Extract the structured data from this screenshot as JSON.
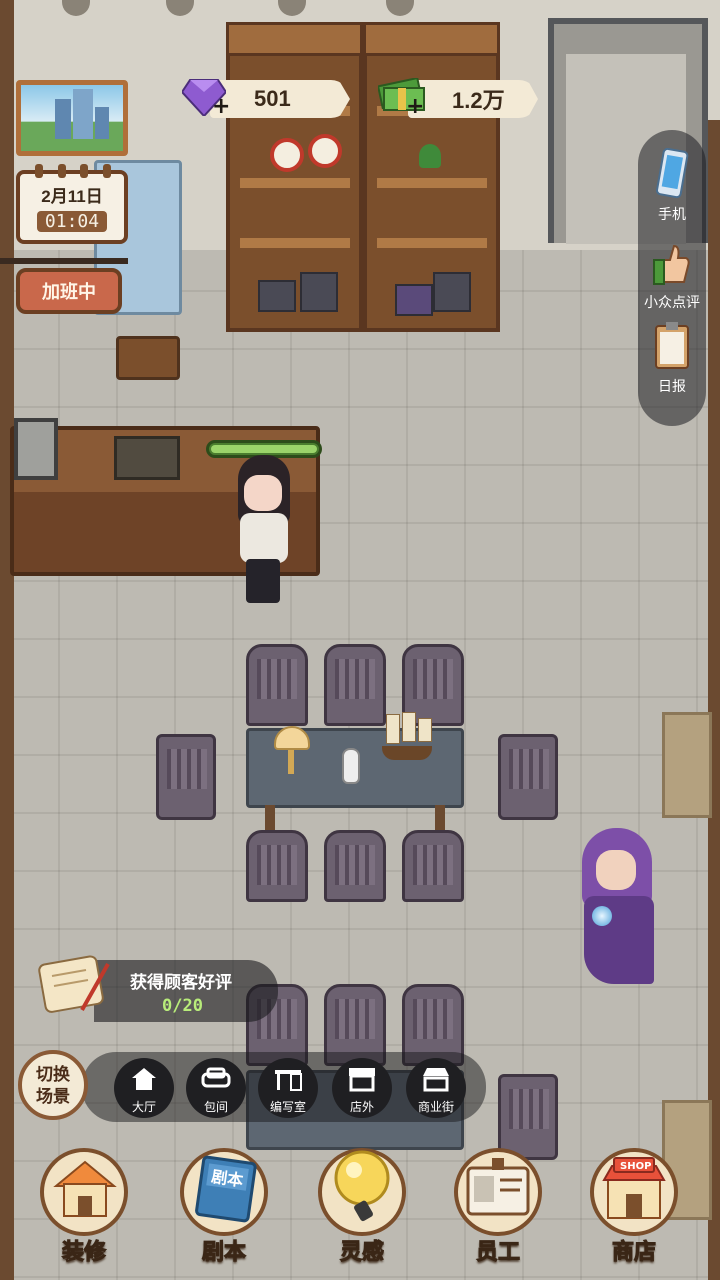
{
  "resources": {
    "gems": "501",
    "cash": "1.2万",
    "plus_symbol": "+"
  },
  "clock": {
    "date": "2月11日",
    "time": "01:04"
  },
  "status_sign": "加班中",
  "side_menu": [
    {
      "label": "手机",
      "icon": "phone-icon"
    },
    {
      "label": "小众点评",
      "icon": "thumbs-up-icon"
    },
    {
      "label": "日报",
      "icon": "clipboard-icon"
    }
  ],
  "task": {
    "title": "获得顾客好评",
    "progress": "0/20"
  },
  "scene_toggle": {
    "line1": "切换",
    "line2": "场景"
  },
  "scenes": [
    {
      "label": "大厅",
      "icon": "house-icon"
    },
    {
      "label": "包间",
      "icon": "sofa-icon"
    },
    {
      "label": "编写室",
      "icon": "desk-icon"
    },
    {
      "label": "店外",
      "icon": "storefront-icon"
    },
    {
      "label": "商业街",
      "icon": "street-icon"
    }
  ],
  "main_menu": [
    {
      "label": "装修",
      "icon": "house-renovate-icon"
    },
    {
      "label": "剧本",
      "icon": "script-book-icon",
      "badge": "剧本"
    },
    {
      "label": "灵感",
      "icon": "lightbulb-icon"
    },
    {
      "label": "员工",
      "icon": "id-card-icon"
    },
    {
      "label": "商店",
      "icon": "shop-icon",
      "badge": "SHOP"
    }
  ],
  "colors": {
    "accent_wood": "#7b4f2c",
    "gem_purple": "#8e5bd0",
    "cash_green": "#4c9a3a",
    "progress_green": "#b8ec7a",
    "sign_red": "#c9684b"
  }
}
